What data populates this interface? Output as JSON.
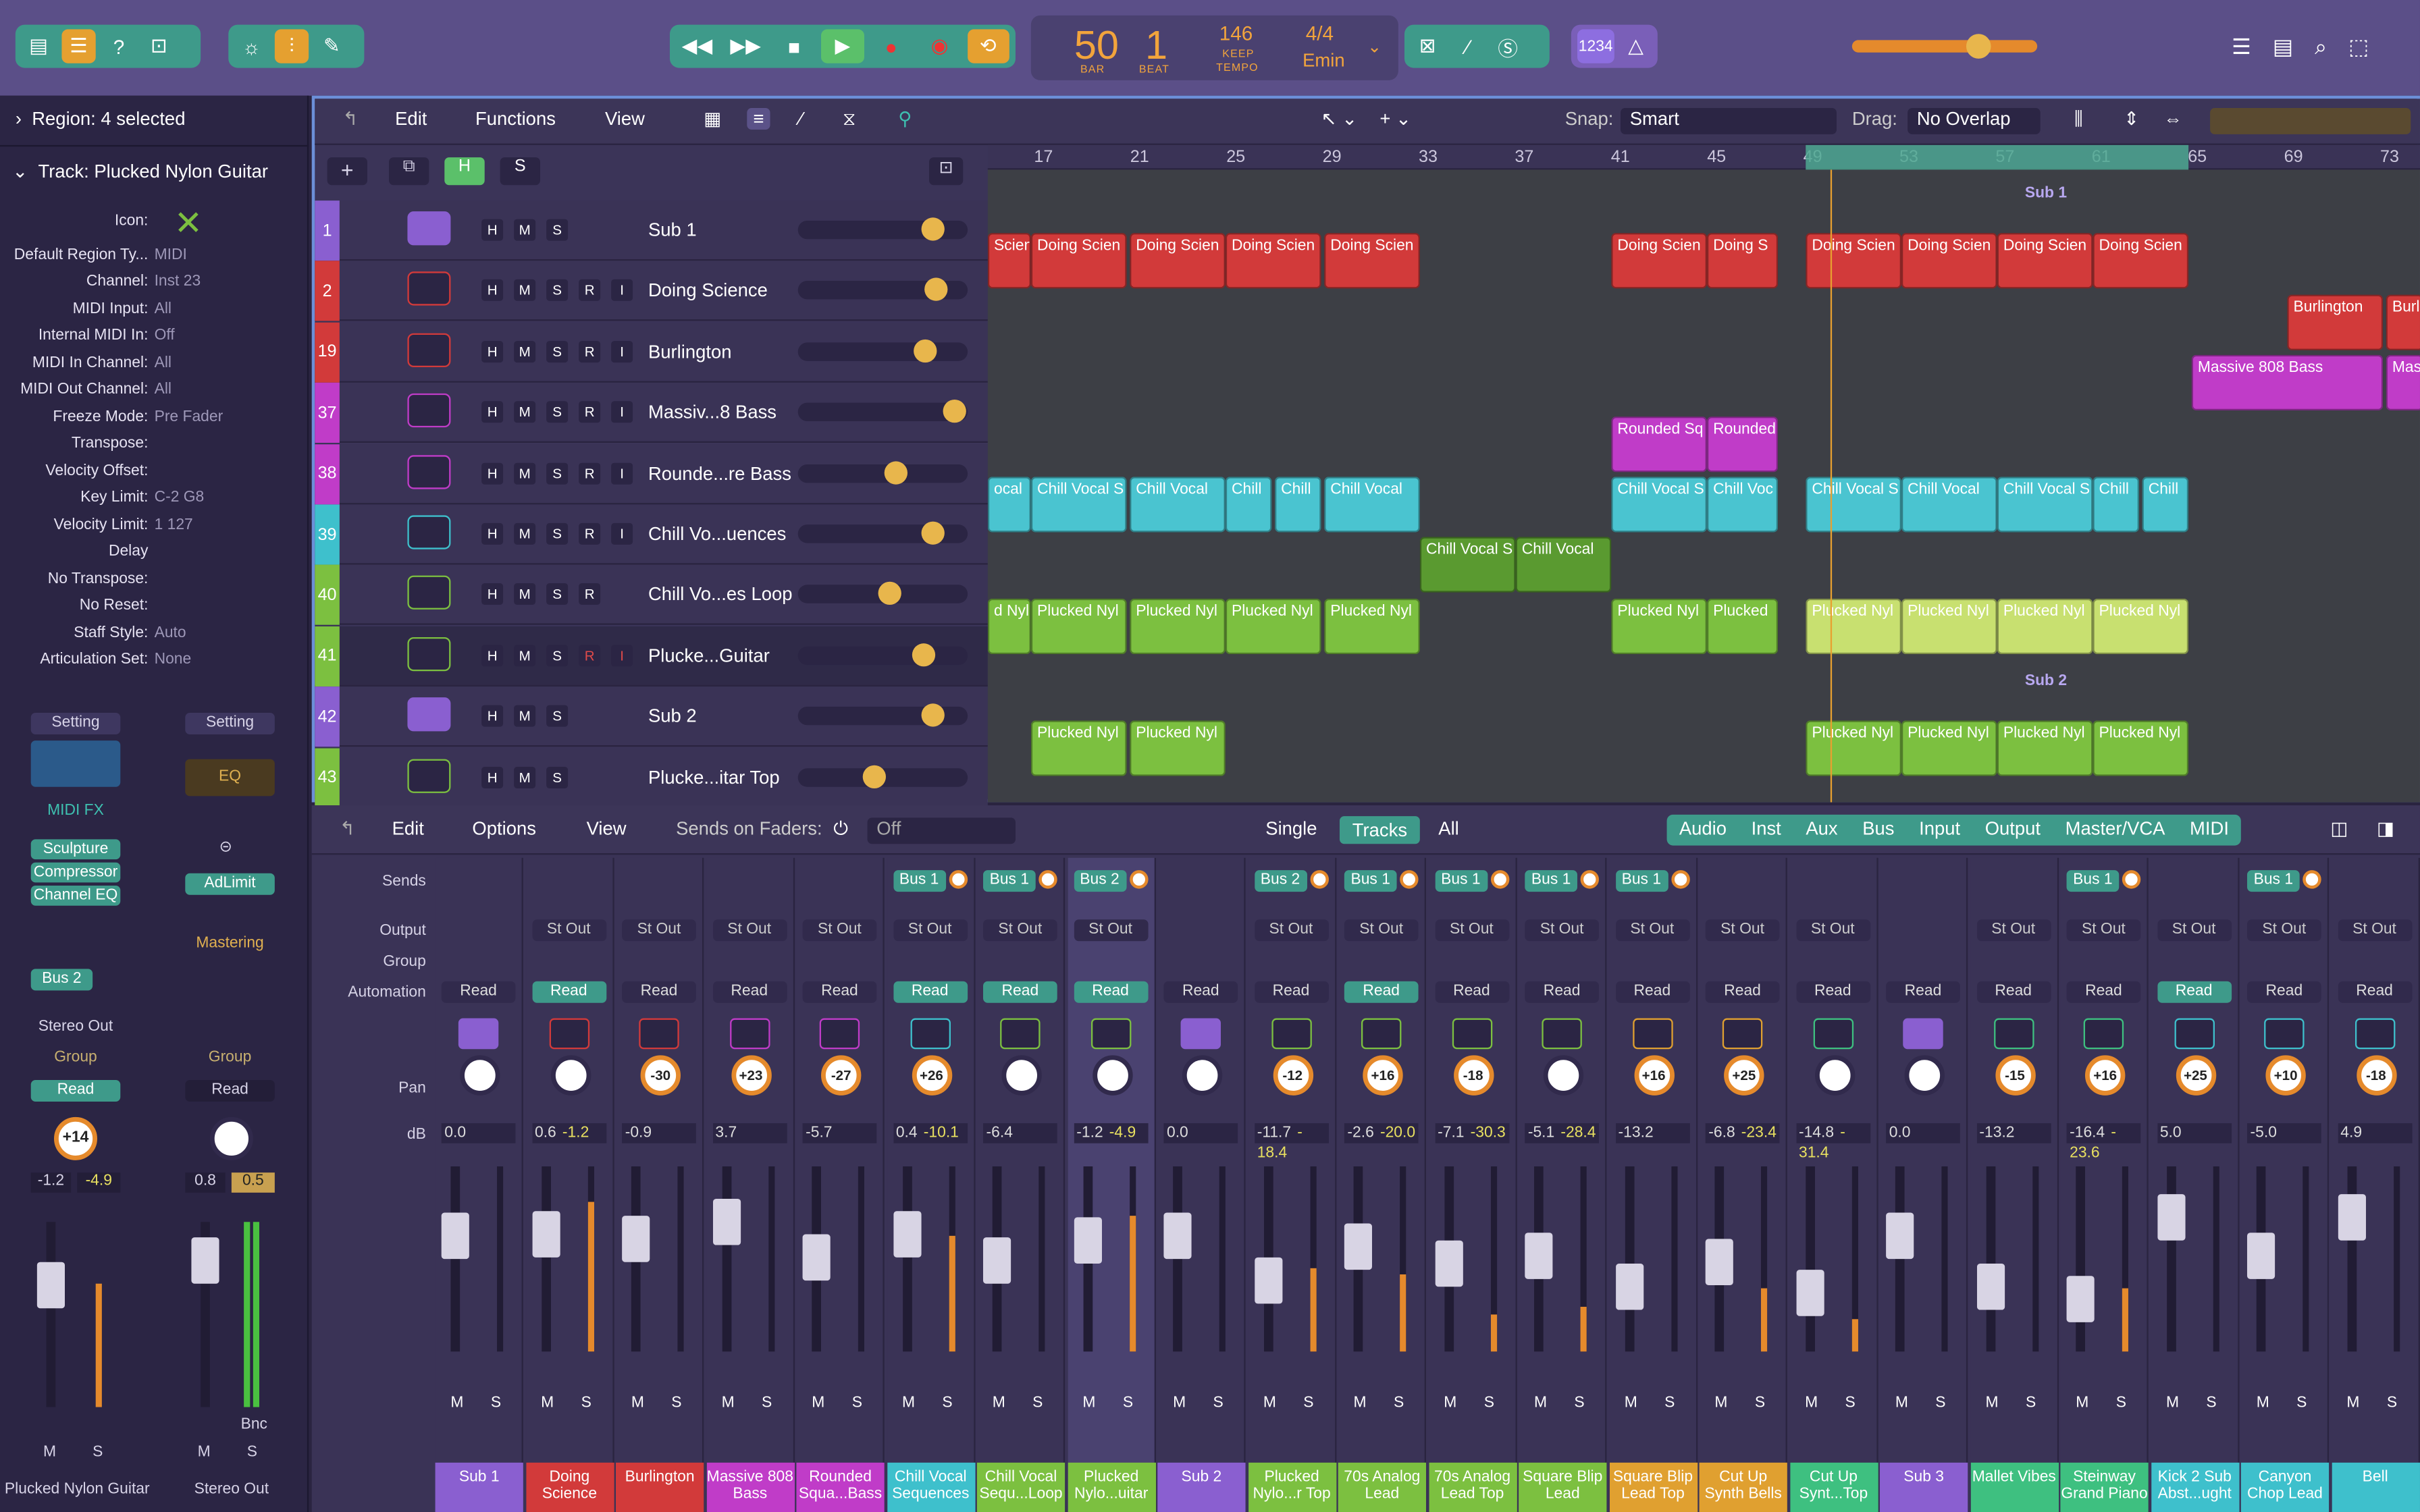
{
  "transport": {
    "bar": "50",
    "beat": "1",
    "bar_label": "BAR",
    "beat_label": "BEAT",
    "tempo": "146",
    "tempo_label": "KEEP",
    "tempo_sub": "TEMPO",
    "signature": "4/4",
    "key": "Emin",
    "lcd_mode": "1234"
  },
  "inspector": {
    "region": "Region: 4 selected",
    "track": "Track: Plucked Nylon Guitar",
    "rows": [
      [
        "Icon:",
        ""
      ],
      [
        "Default Region Ty...",
        "MIDI"
      ],
      [
        "Channel:",
        "Inst 23"
      ],
      [
        "MIDI Input:",
        "All"
      ],
      [
        "Internal MIDI In:",
        "Off"
      ],
      [
        "MIDI In Channel:",
        "All"
      ],
      [
        "MIDI Out Channel:",
        "All"
      ],
      [
        "Freeze Mode:",
        "Pre Fader"
      ],
      [
        "Transpose:",
        ""
      ],
      [
        "Velocity Offset:",
        ""
      ],
      [
        "Key Limit:",
        "C-2  G8"
      ],
      [
        "Velocity Limit:",
        "1  127"
      ],
      [
        "Delay",
        ""
      ],
      [
        "No Transpose:",
        ""
      ],
      [
        "No Reset:",
        ""
      ],
      [
        "Staff Style:",
        "Auto"
      ],
      [
        "Articulation Set:",
        "None"
      ]
    ],
    "strip1": {
      "setting": "Setting",
      "midifx": "MIDI FX",
      "plugins": [
        "Sculpture",
        "Compressor",
        "Channel EQ"
      ],
      "send": "Bus 2",
      "output": "Stereo Out",
      "group": "Group",
      "auto": "Read",
      "pan": "+14",
      "db1": "-1.2",
      "db2": "-4.9",
      "name": "Plucked Nylon Guitar"
    },
    "strip2": {
      "setting": "Setting",
      "eq": "EQ",
      "plugin": "AdLimit",
      "mastering": "Mastering",
      "group": "Group",
      "auto": "Read",
      "db1": "0.8",
      "db2": "0.5",
      "bnc": "Bnc",
      "name": "Stereo Out"
    }
  },
  "tracks_toolbar": {
    "edit": "Edit",
    "functions": "Functions",
    "view": "View",
    "snap_label": "Snap:",
    "snap": "Smart",
    "drag_label": "Drag:",
    "drag": "No Overlap"
  },
  "ruler": [
    "17",
    "21",
    "25",
    "29",
    "33",
    "37",
    "41",
    "45",
    "49",
    "53",
    "57",
    "61",
    "65",
    "69",
    "73"
  ],
  "tracks": [
    {
      "num": "1",
      "name": "Sub 1",
      "color": "#8a5fd0",
      "rec": false
    },
    {
      "num": "2",
      "name": "Doing Science",
      "color": "#d23a3a",
      "rec": true
    },
    {
      "num": "19",
      "name": "Burlington",
      "color": "#d23a3a",
      "rec": true
    },
    {
      "num": "37",
      "name": "Massiv...8 Bass",
      "color": "#c03cc8",
      "rec": true
    },
    {
      "num": "38",
      "name": "Rounde...re Bass",
      "color": "#c03cc8",
      "rec": true
    },
    {
      "num": "39",
      "name": "Chill Vo...uences",
      "color": "#3ec0cc",
      "rec": true
    },
    {
      "num": "40",
      "name": "Chill Vo...es Loop",
      "color": "#7cc040",
      "rec": false
    },
    {
      "num": "41",
      "name": "Plucke...Guitar",
      "color": "#7cc040",
      "rec": true
    },
    {
      "num": "42",
      "name": "Sub 2",
      "color": "#8a5fd0",
      "rec": false
    },
    {
      "num": "43",
      "name": "Plucke...itar Top",
      "color": "#7cc040",
      "rec": false
    }
  ],
  "regions": {
    "sub1": "Sub 1",
    "sub2": "Sub 2",
    "doing": "Doing Scien",
    "doing2": "Doing S",
    "scien": "Scien",
    "burl": "Burlington",
    "burl2": "Burl",
    "massive": "Massive 808 Bass",
    "massive2": "Mas",
    "rounded": "Rounded Sq",
    "rounded2": "Rounded",
    "chill": "Chill Vocal",
    "chills": "Chill Vocal S",
    "chillv": "Chill Voc",
    "chill1": "Chill",
    "ocal": "ocal",
    "plucked": "Plucked Nyl",
    "plucked2": "Plucked",
    "dnyl": "d Nyl"
  },
  "mixer_toolbar": {
    "edit": "Edit",
    "options": "Options",
    "view": "View",
    "sends_on": "Sends on Faders:",
    "off": "Off",
    "single": "Single",
    "tracks": "Tracks",
    "all": "All",
    "filters": [
      "Audio",
      "Inst",
      "Aux",
      "Bus",
      "Input",
      "Output",
      "Master/VCA",
      "MIDI"
    ]
  },
  "mixer_labels": {
    "sends": "Sends",
    "output": "Output",
    "group": "Group",
    "automation": "Automation",
    "pan": "Pan",
    "db": "dB"
  },
  "strips": [
    {
      "name": "Sub 1",
      "color": "#8a5fd0",
      "send": "",
      "out": "",
      "auto": "Read",
      "pan": "",
      "db": "0.0",
      "db2": "",
      "green": false
    },
    {
      "name": "Doing Science",
      "color": "#d23a3a",
      "send": "",
      "out": "St Out",
      "auto": "Read",
      "pan": "",
      "db": "0.6",
      "db2": "-1.2",
      "green": true
    },
    {
      "name": "Burlington",
      "color": "#d23a3a",
      "send": "",
      "out": "St Out",
      "auto": "Read",
      "pan": "-30",
      "db": "-0.9",
      "db2": "",
      "green": false
    },
    {
      "name": "Massive 808 Bass",
      "color": "#c03cc8",
      "send": "",
      "out": "St Out",
      "auto": "Read",
      "pan": "+23",
      "db": "3.7",
      "db2": "",
      "green": false
    },
    {
      "name": "Rounded Squa...Bass",
      "color": "#c03cc8",
      "send": "",
      "out": "St Out",
      "auto": "Read",
      "pan": "-27",
      "db": "-5.7",
      "db2": "",
      "green": false
    },
    {
      "name": "Chill Vocal Sequences",
      "color": "#3ec0cc",
      "send": "Bus 1",
      "out": "St Out",
      "auto": "Read",
      "pan": "+26",
      "db": "0.4",
      "db2": "-10.1",
      "green": true
    },
    {
      "name": "Chill Vocal Sequ...Loop",
      "color": "#7cc040",
      "send": "Bus 1",
      "out": "St Out",
      "auto": "Read",
      "pan": "",
      "db": "-6.4",
      "db2": "",
      "green": true
    },
    {
      "name": "Plucked Nylo...uitar",
      "color": "#7cc040",
      "send": "Bus 2",
      "out": "St Out",
      "auto": "Read",
      "pan": "",
      "db": "-1.2",
      "db2": "-4.9",
      "green": true
    },
    {
      "name": "Sub 2",
      "color": "#8a5fd0",
      "send": "",
      "out": "",
      "auto": "Read",
      "pan": "",
      "db": "0.0",
      "db2": "",
      "green": false
    },
    {
      "name": "Plucked Nylo...r Top",
      "color": "#7cc040",
      "send": "Bus 2",
      "out": "St Out",
      "auto": "Read",
      "pan": "-12",
      "db": "-11.7",
      "db2": "-18.4",
      "green": false
    },
    {
      "name": "70s Analog Lead",
      "color": "#7cc040",
      "send": "Bus 1",
      "out": "St Out",
      "auto": "Read",
      "pan": "+16",
      "db": "-2.6",
      "db2": "-20.0",
      "green": true
    },
    {
      "name": "70s Analog Lead Top",
      "color": "#7cc040",
      "send": "Bus 1",
      "out": "St Out",
      "auto": "Read",
      "pan": "-18",
      "db": "-7.1",
      "db2": "-30.3",
      "green": false
    },
    {
      "name": "Square Blip Lead",
      "color": "#7cc040",
      "send": "Bus 1",
      "out": "St Out",
      "auto": "Read",
      "pan": "",
      "db": "-5.1",
      "db2": "-28.4",
      "green": false
    },
    {
      "name": "Square Blip Lead Top",
      "color": "#e0a030",
      "send": "Bus 1",
      "out": "St Out",
      "auto": "Read",
      "pan": "+16",
      "db": "-13.2",
      "db2": "",
      "green": false
    },
    {
      "name": "Cut Up Synth Bells",
      "color": "#e0a030",
      "send": "",
      "out": "St Out",
      "auto": "Read",
      "pan": "+25",
      "db": "-6.8",
      "db2": "-23.4",
      "green": false
    },
    {
      "name": "Cut Up Synt...Top",
      "color": "#3ec080",
      "send": "",
      "out": "St Out",
      "auto": "Read",
      "pan": "",
      "db": "-14.8",
      "db2": "-31.4",
      "green": false
    },
    {
      "name": "Sub 3",
      "color": "#8a5fd0",
      "send": "",
      "out": "",
      "auto": "Read",
      "pan": "",
      "db": "0.0",
      "db2": "",
      "green": false
    },
    {
      "name": "Mallet Vibes",
      "color": "#3ec080",
      "send": "",
      "out": "St Out",
      "auto": "Read",
      "pan": "-15",
      "db": "-13.2",
      "db2": "",
      "green": false
    },
    {
      "name": "Steinway Grand Piano",
      "color": "#3ec080",
      "send": "Bus 1",
      "out": "St Out",
      "auto": "Read",
      "pan": "+16",
      "db": "-16.4",
      "db2": "-23.6",
      "green": false
    },
    {
      "name": "Kick 2 Sub Abst...ught",
      "color": "#3ec0cc",
      "send": "",
      "out": "St Out",
      "auto": "Read",
      "pan": "+25",
      "db": "5.0",
      "db2": "",
      "green": true
    },
    {
      "name": "Canyon Chop Lead",
      "color": "#3ec0cc",
      "send": "Bus 1",
      "out": "St Out",
      "auto": "Read",
      "pan": "+10",
      "db": "-5.0",
      "db2": "",
      "green": false
    },
    {
      "name": "Bell",
      "color": "#3ec0cc",
      "send": "",
      "out": "St Out",
      "auto": "Read",
      "pan": "-18",
      "db": "4.9",
      "db2": "",
      "green": false
    }
  ]
}
